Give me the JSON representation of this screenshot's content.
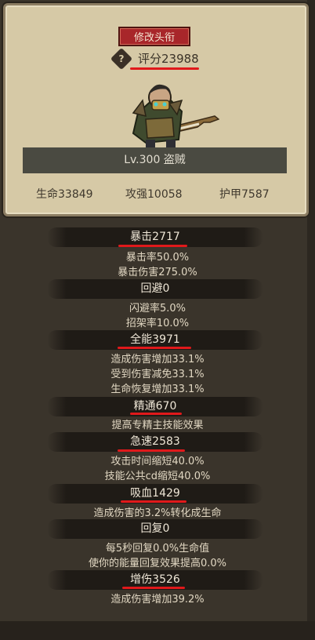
{
  "profile": {
    "rename_label": "修改头衔",
    "help_glyph": "?",
    "score": "评分23988",
    "level": "Lv.300 盗贼",
    "hp": "生命33849",
    "atk": "攻强10058",
    "armor": "护甲7587"
  },
  "stats": [
    {
      "title": "暴击2717",
      "lines": [
        "暴击率50.0%",
        "暴击伤害275.0%"
      ]
    },
    {
      "title": "回避0",
      "lines": [
        "闪避率5.0%",
        "招架率10.0%"
      ]
    },
    {
      "title": "全能3971",
      "lines": [
        "造成伤害增加33.1%",
        "受到伤害减免33.1%",
        "生命恢复增加33.1%"
      ]
    },
    {
      "title": "精通670",
      "lines": [
        "提高专精主技能效果"
      ]
    },
    {
      "title": "急速2583",
      "lines": [
        "攻击时间缩短40.0%",
        "技能公共cd缩短40.0%"
      ]
    },
    {
      "title": "吸血1429",
      "lines": [
        "造成伤害的3.2%转化成生命"
      ]
    },
    {
      "title": "回复0",
      "lines": [
        "每5秒回复0.0%生命值",
        "使你的能量回复效果提高0.0%"
      ]
    },
    {
      "title": "增伤3526",
      "lines": [
        "造成伤害增加39.2%"
      ]
    }
  ],
  "colors": {
    "accent_red": "#e0191b",
    "button_red": "#a8262a"
  }
}
